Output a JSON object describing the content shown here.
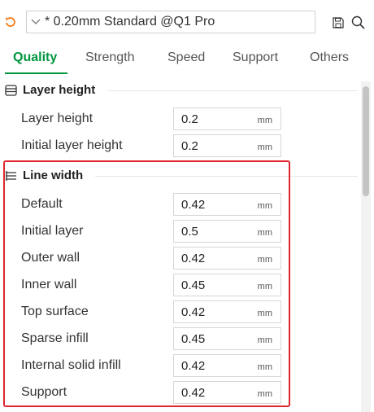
{
  "toolbar": {
    "preset_label": "* 0.20mm Standard @Q1 Pro",
    "icons": {
      "reset": "reset-arrow-icon",
      "chevron": "chevron-down-icon",
      "save": "save-icon",
      "search": "search-icon"
    },
    "accent_color": "#00963f",
    "reset_color": "#f07c1b"
  },
  "tabs": [
    {
      "label": "Quality",
      "active": true
    },
    {
      "label": "Strength",
      "active": false
    },
    {
      "label": "Speed",
      "active": false
    },
    {
      "label": "Support",
      "active": false
    },
    {
      "label": "Others",
      "active": false
    }
  ],
  "sections": {
    "layer_height": {
      "title": "Layer height",
      "icon": "layer-stack-icon",
      "rows": [
        {
          "label": "Layer height",
          "value": "0.2",
          "unit": "mm"
        },
        {
          "label": "Initial layer height",
          "value": "0.2",
          "unit": "mm"
        }
      ]
    },
    "line_width": {
      "title": "Line width",
      "icon": "line-width-icon",
      "highlight_color": "#e0262f",
      "rows": [
        {
          "label": "Default",
          "value": "0.42",
          "unit": "mm"
        },
        {
          "label": "Initial layer",
          "value": "0.5",
          "unit": "mm"
        },
        {
          "label": "Outer wall",
          "value": "0.42",
          "unit": "mm"
        },
        {
          "label": "Inner wall",
          "value": "0.45",
          "unit": "mm"
        },
        {
          "label": "Top surface",
          "value": "0.42",
          "unit": "mm"
        },
        {
          "label": "Sparse infill",
          "value": "0.45",
          "unit": "mm"
        },
        {
          "label": "Internal solid infill",
          "value": "0.42",
          "unit": "mm"
        },
        {
          "label": "Support",
          "value": "0.42",
          "unit": "mm"
        }
      ]
    }
  }
}
